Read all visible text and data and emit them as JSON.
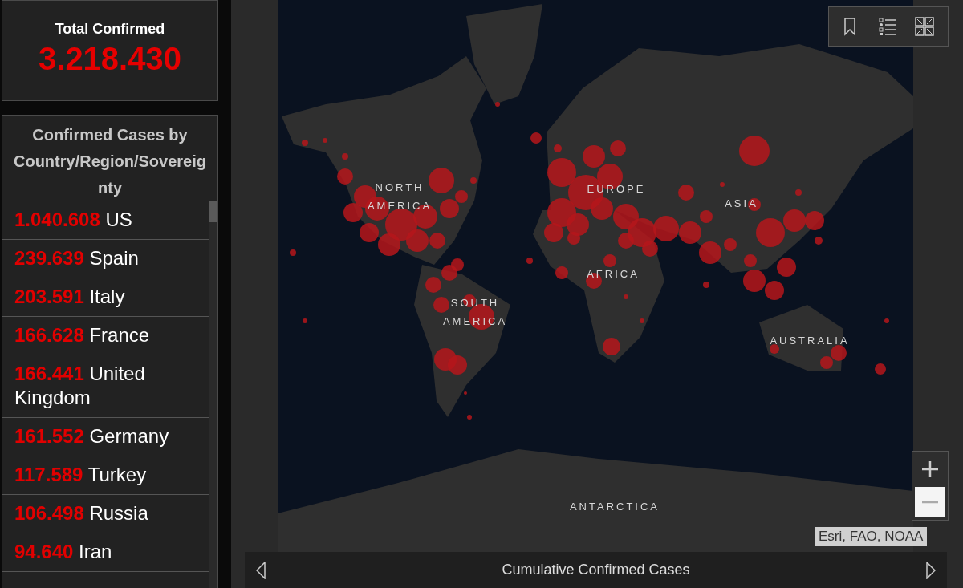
{
  "total": {
    "label": "Total Confirmed",
    "value": "3.218.430"
  },
  "case_list": {
    "title": "Confirmed Cases by Country/Region/Sovereignty",
    "rows": [
      {
        "count": "1.040.608",
        "name": "US"
      },
      {
        "count": "239.639",
        "name": "Spain"
      },
      {
        "count": "203.591",
        "name": "Italy"
      },
      {
        "count": "166.628",
        "name": "France"
      },
      {
        "count": "166.441",
        "name": "United Kingdom"
      },
      {
        "count": "161.552",
        "name": "Germany"
      },
      {
        "count": "117.589",
        "name": "Turkey"
      },
      {
        "count": "106.498",
        "name": "Russia"
      },
      {
        "count": "94.640",
        "name": "Iran"
      }
    ]
  },
  "map": {
    "region_labels": [
      "NORTH AMERICA",
      "EUROPE",
      "ASIA",
      "AFRICA",
      "SOUTH AMERICA",
      "AUSTRALIA",
      "ANTARCTICA"
    ],
    "attribution": "Esri, FAO, NOAA"
  },
  "bottom_bar": {
    "title": "Cumulative Confirmed Cases"
  }
}
